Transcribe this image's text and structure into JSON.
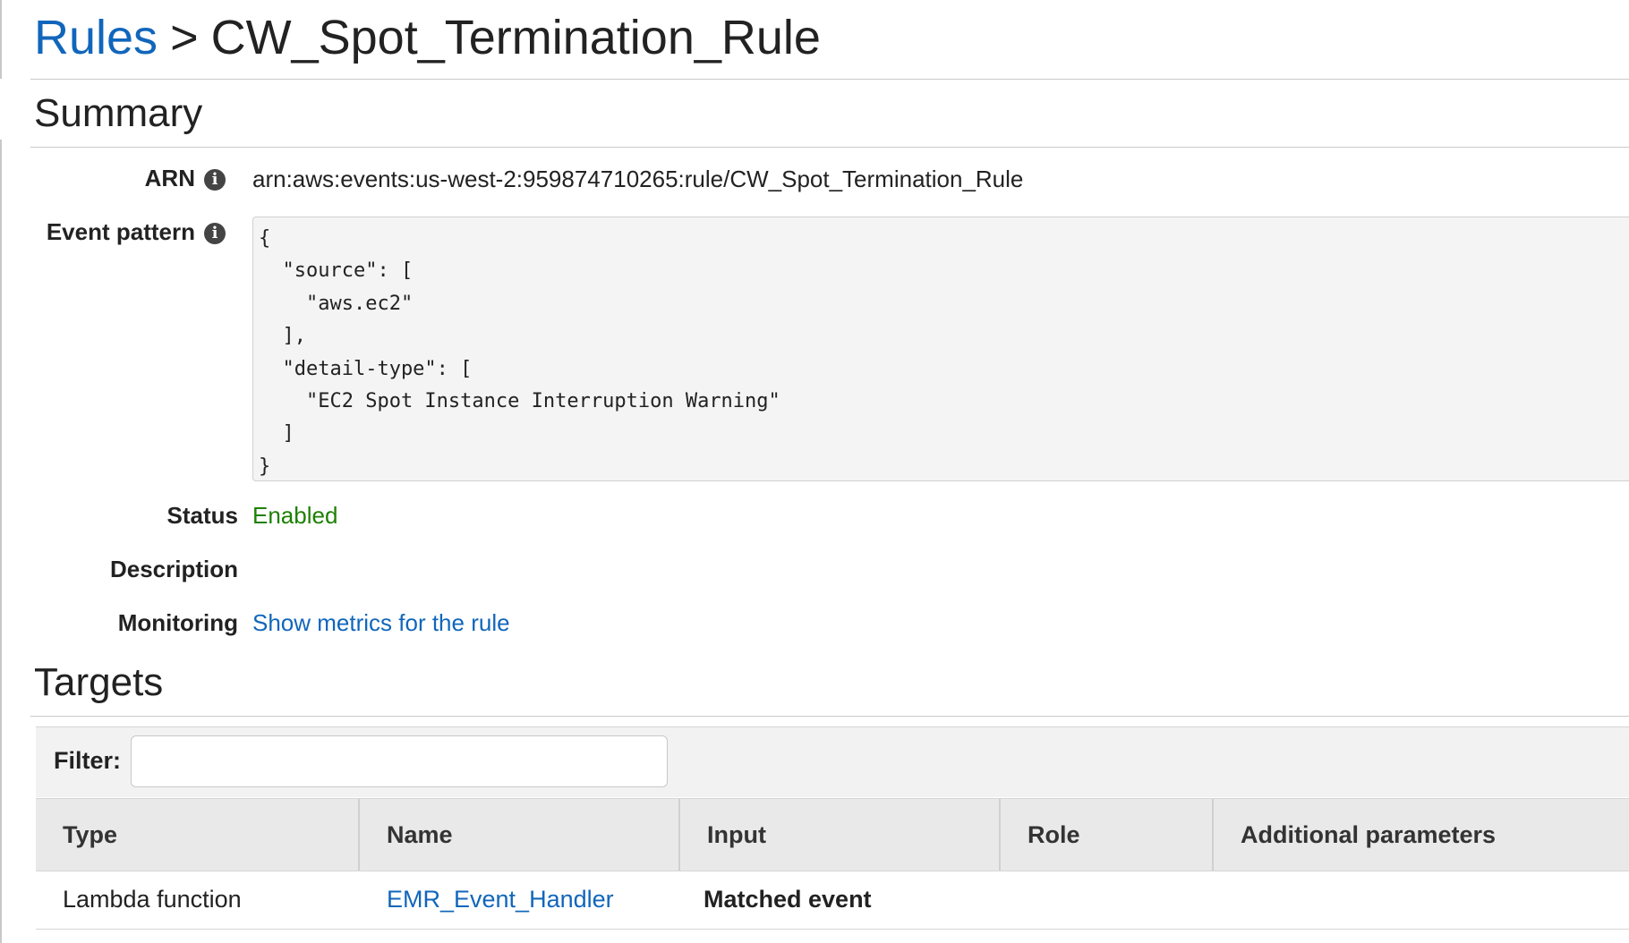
{
  "breadcrumb": {
    "root_label": "Rules",
    "separator": ">",
    "current": "CW_Spot_Termination_Rule"
  },
  "summary": {
    "title": "Summary",
    "arn_label": "ARN",
    "arn_value": "arn:aws:events:us-west-2:959874710265:rule/CW_Spot_Termination_Rule",
    "event_pattern_label": "Event pattern",
    "event_pattern_lines": [
      "{",
      "  \"source\": [",
      "    \"aws.ec2\"",
      "  ],",
      "  \"detail-type\": [",
      "    \"EC2 Spot Instance Interruption Warning\"",
      "  ]",
      "}"
    ],
    "status_label": "Status",
    "status_value": "Enabled",
    "description_label": "Description",
    "description_value": "",
    "monitoring_label": "Monitoring",
    "monitoring_link": "Show metrics for the rule"
  },
  "targets": {
    "title": "Targets",
    "filter_label": "Filter:",
    "filter_value": "",
    "columns": [
      "Type",
      "Name",
      "Input",
      "Role",
      "Additional parameters"
    ],
    "rows": [
      {
        "type": "Lambda function",
        "name": "EMR_Event_Handler",
        "input": "Matched event",
        "role": "",
        "additional": ""
      }
    ]
  },
  "colors": {
    "link": "#1166bb",
    "status_enabled": "#1d8102",
    "code_background": "#f4f4f4",
    "table_header_background": "#e9e9e9"
  },
  "icons": {
    "info": "info-circle-icon"
  }
}
